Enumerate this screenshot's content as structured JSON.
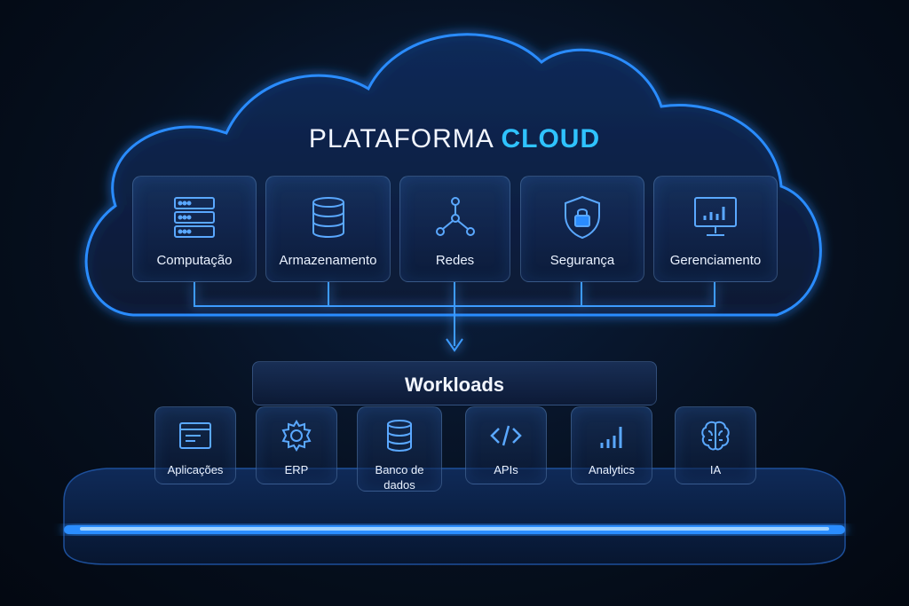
{
  "title": {
    "main": "PLATAFORMA",
    "accent": "CLOUD"
  },
  "services": [
    {
      "label": "Computação",
      "icon": "server-icon"
    },
    {
      "label": "Armazenamento",
      "icon": "database-icon"
    },
    {
      "label": "Redes",
      "icon": "network-icon"
    },
    {
      "label": "Segurança",
      "icon": "shield-lock-icon"
    },
    {
      "label": "Gerenciamento",
      "icon": "monitor-chart-icon"
    }
  ],
  "workloads": {
    "title": "Workloads",
    "items": [
      {
        "label": "Aplicações",
        "icon": "app-window-icon"
      },
      {
        "label": "ERP",
        "icon": "gear-icon"
      },
      {
        "label": "Banco de\ndados",
        "icon": "database-icon"
      },
      {
        "label": "APIs",
        "icon": "code-icon"
      },
      {
        "label": "Analytics",
        "icon": "bar-chart-icon"
      },
      {
        "label": "IA",
        "icon": "brain-icon"
      }
    ]
  },
  "colors": {
    "accent": "#2fc3ff",
    "glow": "#1e7bff",
    "icon": "#5aa8ff"
  }
}
